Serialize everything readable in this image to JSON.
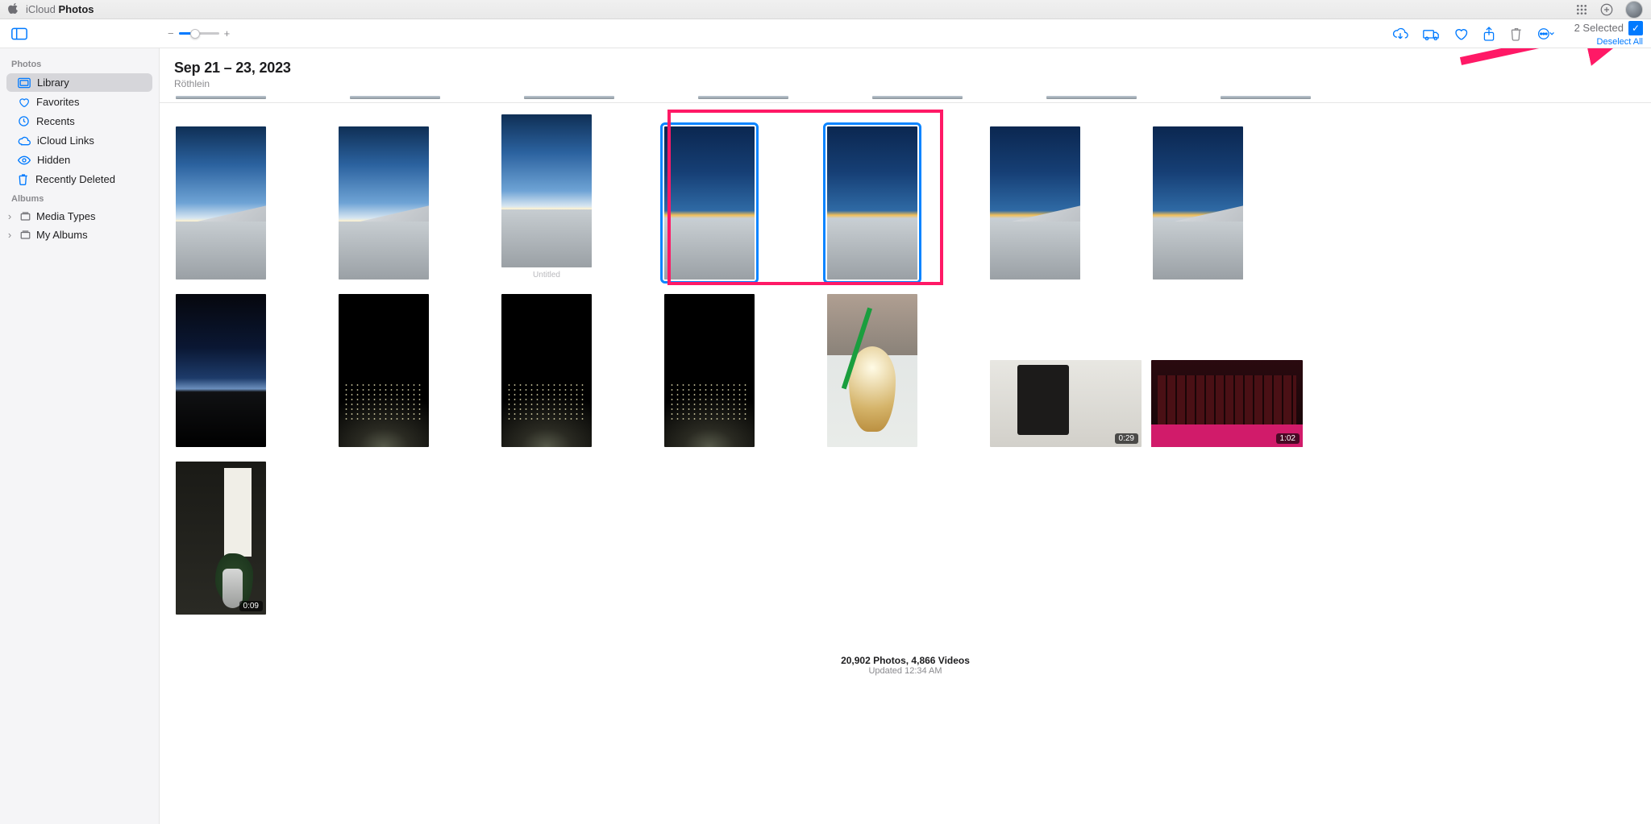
{
  "titlebar": {
    "app_prefix": "iCloud",
    "app_name": "Photos"
  },
  "sidebar": {
    "sections": {
      "photos_label": "Photos",
      "albums_label": "Albums"
    },
    "items": {
      "library": "Library",
      "favorites": "Favorites",
      "recents": "Recents",
      "icloud_links": "iCloud Links",
      "hidden": "Hidden",
      "recently_deleted": "Recently Deleted",
      "media_types": "Media Types",
      "my_albums": "My Albums"
    }
  },
  "toolbar": {
    "selected_text": "2 Selected",
    "deselect_text": "Deselect All"
  },
  "header": {
    "date_title": "Sep 21 – 23, 2023",
    "location": "Röthlein"
  },
  "grid": {
    "row1_caption_untitled": "Untitled",
    "video_durations": {
      "indoor_clip": "0:29",
      "keyboard_clip": "1:02",
      "room_clip": "0:09"
    }
  },
  "footer": {
    "counts": "20,902 Photos, 4,866 Videos",
    "updated": "Updated 12:34 AM"
  }
}
